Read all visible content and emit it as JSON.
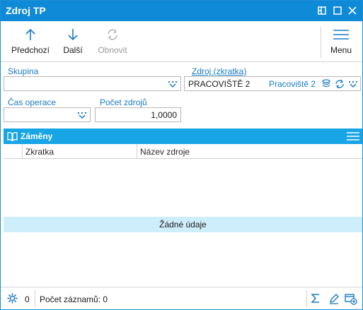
{
  "window": {
    "title": "Zdroj TP"
  },
  "toolbar": {
    "previous_label": "Předchozí",
    "next_label": "Další",
    "refresh_label": "Obnovit",
    "menu_label": "Menu"
  },
  "form": {
    "group_label": "Skupina",
    "group_value": "",
    "source_label": "Zdroj (zkratka)",
    "source_value": "PRACOVIŠTĚ 2",
    "source_name": "Pracoviště 2",
    "operation_time_label": "Čas operace",
    "operation_time_value": "",
    "source_count_label": "Počet zdrojů",
    "source_count_value": "1,0000"
  },
  "panel": {
    "title": "Záměny",
    "columns": [
      "Zkratka",
      "Název zdroje"
    ],
    "empty_text": "Žádné údaje"
  },
  "status": {
    "selected_count": "0",
    "record_count_text": "Počet záznamů: 0"
  },
  "colors": {
    "titlebar": "#0f8ad6",
    "panel_header": "#18a5e6",
    "label": "#1a7bc4",
    "empty_row": "#cfeefb"
  }
}
